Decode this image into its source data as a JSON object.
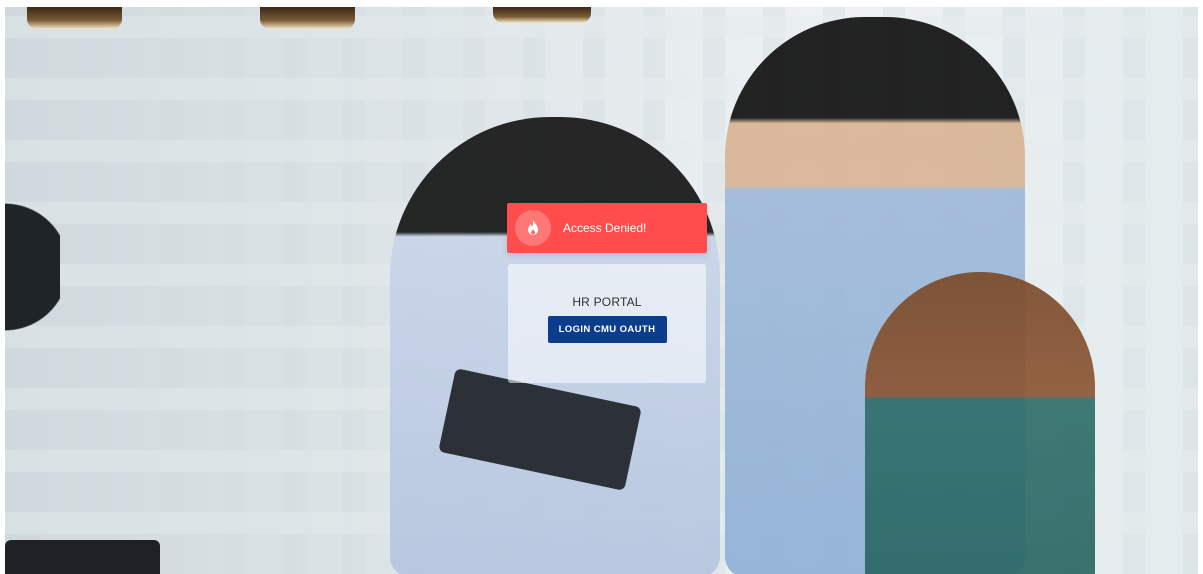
{
  "alert": {
    "icon": "fire-icon",
    "message": "Access Denied!",
    "color": "#ff4d4d"
  },
  "login_card": {
    "title": "HR PORTAL",
    "button_label": "LOGIN CMU OAUTH",
    "button_color": "#0c3d8c"
  }
}
